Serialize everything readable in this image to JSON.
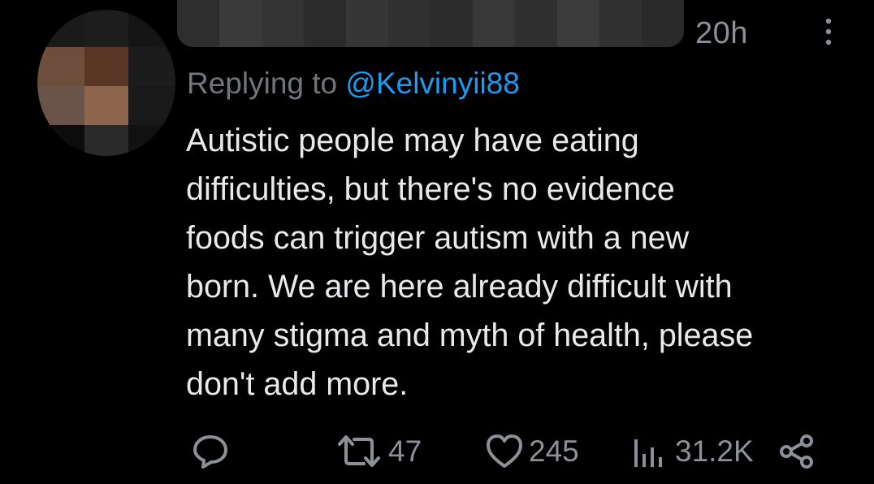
{
  "tweet": {
    "timestamp": "20h",
    "replying_prefix": "Replying to ",
    "replying_handle": "@Kelvinyii88",
    "body_lines": [
      "Autistic people may have eating",
      "difficulties, but there's no evidence",
      "foods can trigger autism with a new",
      "born. We are here already difficult with",
      "many stigma and myth of health, please",
      "don't add more."
    ]
  },
  "actions": {
    "reply_icon": "reply-bubble-icon",
    "retweet_icon": "retweet-icon",
    "retweet_count": "47",
    "like_icon": "heart-icon",
    "like_count": "245",
    "views_icon": "bar-chart-icon",
    "views_count": "31.2K",
    "share_icon": "share-icon"
  },
  "colors": {
    "background": "#000000",
    "text": "#e7e9ea",
    "muted": "#71767b",
    "link": "#1d9bf0"
  }
}
